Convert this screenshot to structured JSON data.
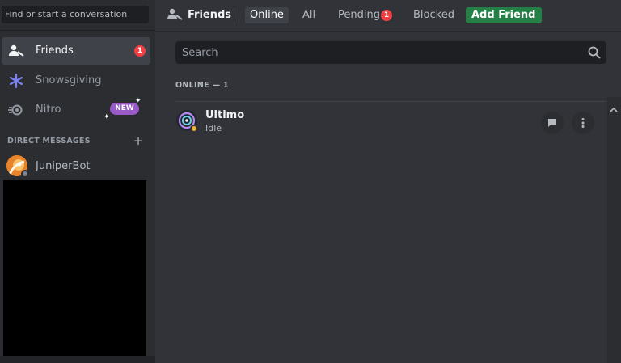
{
  "sidebar": {
    "find_placeholder": "Find or start a conversation",
    "items": [
      {
        "label": "Friends",
        "icon": "friends-icon",
        "badge": "1"
      },
      {
        "label": "Snowsgiving",
        "icon": "snowflake-icon"
      },
      {
        "label": "Nitro",
        "icon": "nitro-icon",
        "badge": "NEW"
      }
    ],
    "dm_header": "DIRECT MESSAGES",
    "dm_add": "+",
    "direct_messages": [
      {
        "name": "JuniperBot",
        "icon": "juniperbot-avatar",
        "status": "offline"
      }
    ]
  },
  "topbar": {
    "title": "Friends",
    "tabs": [
      "Online",
      "All",
      "Pending",
      "Blocked"
    ],
    "pending_badge": "1",
    "add_friend": "Add Friend"
  },
  "search": {
    "placeholder": "Search"
  },
  "friends": {
    "header": "ONLINE — 1",
    "list": [
      {
        "name": "Ultimo",
        "status": "Idle",
        "icon": "ultimo-avatar"
      }
    ]
  },
  "colors": {
    "background": "#313338",
    "sidebar": "#2b2d31",
    "accent_green": "#248046",
    "badge_red": "#f23f43",
    "nitro_purple": "#9a5ac8",
    "idle_yellow": "#f0b232"
  }
}
